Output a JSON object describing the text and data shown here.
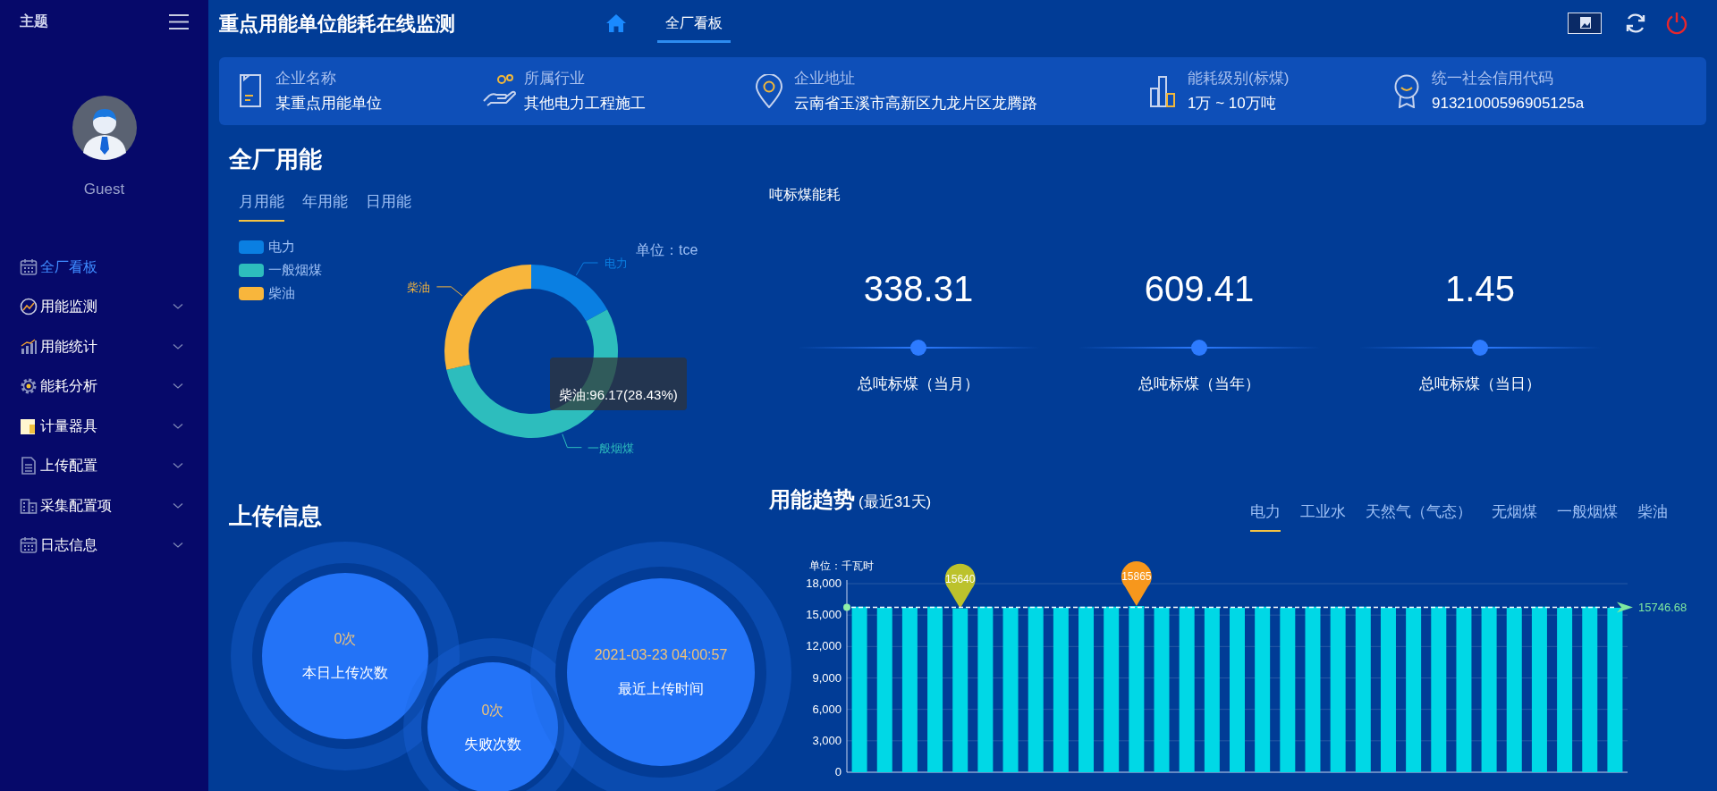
{
  "sidebar": {
    "theme_label": "主题",
    "user": {
      "name": "Guest"
    },
    "items": [
      {
        "label": "全厂看板",
        "selected": true,
        "expandable": false
      },
      {
        "label": "用能监测",
        "selected": false,
        "expandable": true
      },
      {
        "label": "用能统计",
        "selected": false,
        "expandable": true
      },
      {
        "label": "能耗分析",
        "selected": false,
        "expandable": true
      },
      {
        "label": "计量器具",
        "selected": false,
        "expandable": true
      },
      {
        "label": "上传配置",
        "selected": false,
        "expandable": true
      },
      {
        "label": "采集配置项",
        "selected": false,
        "expandable": true
      },
      {
        "label": "日志信息",
        "selected": false,
        "expandable": true
      }
    ]
  },
  "header": {
    "title": "重点用能单位能耗在线监测",
    "nav_tabs": [
      {
        "label": "全厂看板",
        "selected": true
      }
    ]
  },
  "info": [
    {
      "label": "企业名称",
      "value": "某重点用能单位"
    },
    {
      "label": "所属行业",
      "value": "其他电力工程施工"
    },
    {
      "label": "企业地址",
      "value": "云南省玉溪市高新区九龙片区龙腾路"
    },
    {
      "label": "能耗级别(标煤)",
      "value": "1万 ~ 10万吨"
    },
    {
      "label": "统一社会信用代码",
      "value": "91321000596905125a"
    }
  ],
  "energy": {
    "title": "全厂用能",
    "tabs": [
      {
        "label": "月用能",
        "selected": true
      },
      {
        "label": "年用能",
        "selected": false
      },
      {
        "label": "日用能",
        "selected": false
      }
    ],
    "legend": [
      {
        "label": "电力",
        "color": "#0a7fe2"
      },
      {
        "label": "一般烟煤",
        "color": "#2dbdbd"
      },
      {
        "label": "柴油",
        "color": "#f8b63c"
      }
    ],
    "unit": "单位：tce",
    "chart_data": {
      "type": "donut",
      "categories": [
        "电力",
        "一般烟煤",
        "柴油"
      ],
      "values": [
        17,
        54.57,
        28.43
      ]
    },
    "tooltip": "柴油:96.17(28.43%)"
  },
  "kpi": {
    "title": "吨标煤能耗",
    "items": [
      {
        "value": "338.31",
        "label": "总吨标煤（当月）"
      },
      {
        "value": "609.41",
        "label": "总吨标煤（当年）"
      },
      {
        "value": "1.45",
        "label": "总吨标煤（当日）"
      }
    ]
  },
  "upload": {
    "title": "上传信息",
    "circles": [
      {
        "value": "0次",
        "label": "本日上传次数"
      },
      {
        "value": "0次",
        "label": "失败次数"
      },
      {
        "value": "2021-03-23 04:00:57",
        "label": "最近上传时间"
      }
    ]
  },
  "trend": {
    "title": "用能趋势",
    "subtitle": "(最近31天)",
    "tabs": [
      {
        "label": "电力",
        "selected": true
      },
      {
        "label": "工业水",
        "selected": false
      },
      {
        "label": "天然气（气态）",
        "selected": false
      },
      {
        "label": "无烟煤",
        "selected": false
      },
      {
        "label": "一般烟煤",
        "selected": false
      },
      {
        "label": "柴油",
        "selected": false
      }
    ],
    "chart_data": {
      "type": "bar",
      "ylabel": "单位：千瓦时",
      "ylim": [
        0,
        18000
      ],
      "yticks": [
        {
          "value": 0,
          "label": "0"
        },
        {
          "value": 3000,
          "label": "3,000"
        },
        {
          "value": 6000,
          "label": "6,000"
        },
        {
          "value": 9000,
          "label": "9,000"
        },
        {
          "value": 12000,
          "label": "12,000"
        },
        {
          "value": 15000,
          "label": "15,000"
        },
        {
          "value": 18000,
          "label": "18,000"
        }
      ],
      "values": [
        15800,
        15700,
        15700,
        15800,
        15640,
        15800,
        15700,
        15800,
        15700,
        15800,
        15800,
        15865,
        15700,
        15800,
        15700,
        15700,
        15800,
        15700,
        15800,
        15800,
        15800,
        15700,
        15700,
        15800,
        15700,
        15800,
        15700,
        15800,
        15700,
        15800,
        15700
      ],
      "grid": true,
      "annotations": [
        {
          "y": 15640,
          "text": "15640"
        },
        {
          "y": 15865,
          "text": "15865"
        }
      ],
      "ref_lines": [
        {
          "axis": "y",
          "value": 15746.68,
          "label": "15746.68"
        }
      ]
    }
  }
}
